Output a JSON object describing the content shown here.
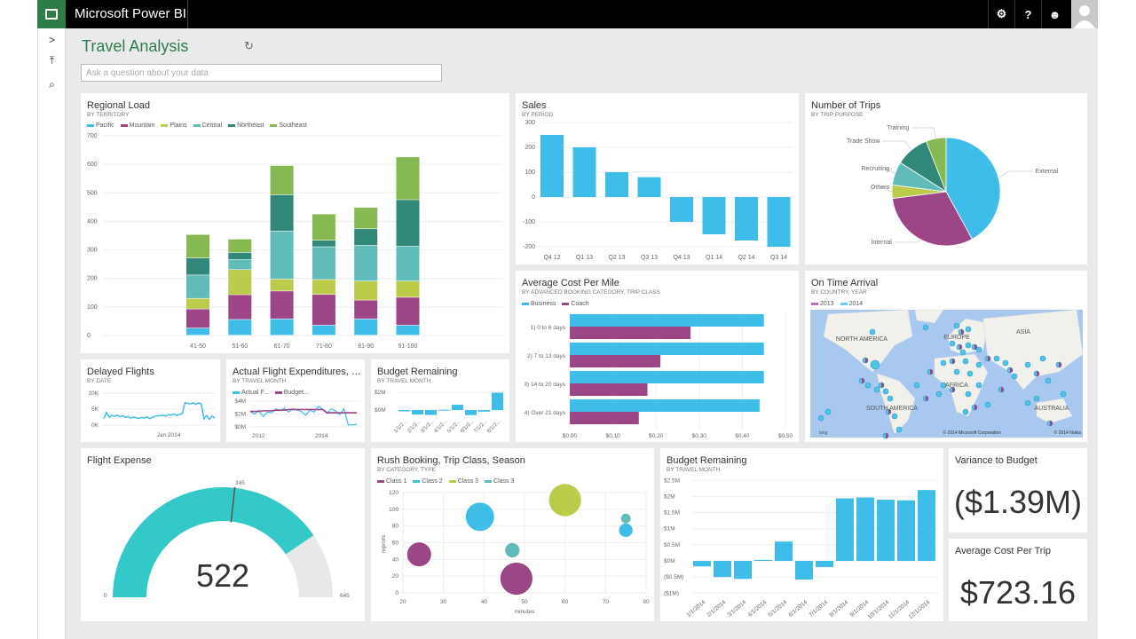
{
  "app": {
    "title": "Microsoft Power BI",
    "icons": [
      "gear-icon",
      "help-icon",
      "feedback-smiley-icon",
      "user-avatar-icon"
    ],
    "help_glyph": "?"
  },
  "nav": {
    "expand": ">",
    "pin": "⤒",
    "search": "⌕"
  },
  "dashboard": {
    "title": "Travel Analysis",
    "qa_placeholder": "Ask a question about your data"
  },
  "colors": {
    "pacific": "#3fbde9",
    "mountain": "#9c4587",
    "plains": "#bccb4a",
    "central": "#5fbcb9",
    "northeast": "#318878",
    "southeast": "#86b952",
    "gauge": "#33c9c9",
    "map": "#a9c8ef"
  },
  "tiles": {
    "regional": {
      "title": "Regional Load",
      "subtitle": "BY TERRITORY"
    },
    "sales": {
      "title": "Sales",
      "subtitle": "BY PERIOD"
    },
    "trips": {
      "title": "Number of Trips",
      "subtitle": "BY TRIP PURPOSE"
    },
    "cost_mile": {
      "title": "Average Cost Per Mile",
      "subtitle": "BY ADVANCED BOOKING CATEGORY, TRIP CLASS"
    },
    "ontime": {
      "title": "On Time Arrival",
      "subtitle": "BY COUNTRY, YEAR",
      "legend": [
        "2013",
        "2014"
      ],
      "labels": [
        "NORTH AMERICA",
        "EUROPE",
        "ASIA",
        "AFRICA",
        "SOUTH AMERICA",
        "AUSTRALIA"
      ],
      "credits": [
        "© 2014 Microsoft Corporation",
        "© 2014 Nokia"
      ],
      "brand": "bing"
    },
    "delayed": {
      "title": "Delayed Flights",
      "subtitle": "BY DATE"
    },
    "actual": {
      "title": "Actual Flight Expenditures, Bu...",
      "subtitle": "BY TRAVEL MONTH"
    },
    "budget_small": {
      "title": "Budget Remaining",
      "subtitle": "BY TRAVEL MONTH"
    },
    "flight_expense": {
      "title": "Flight Expense"
    },
    "rush": {
      "title": "Rush Booking, Trip Class, Season",
      "subtitle": "BY CATEGORY, TYPE"
    },
    "budget_large": {
      "title": "Budget Remaining",
      "subtitle": "BY TRAVEL MONTH"
    },
    "variance": {
      "title": "Variance to Budget",
      "value": "($1.39M)"
    },
    "cost_trip": {
      "title": "Average Cost Per Trip",
      "value": "$723.16"
    }
  },
  "chart_data": [
    {
      "id": "regional",
      "type": "bar",
      "stacked": true,
      "categories": [
        "41-50",
        "51-60",
        "61-70",
        "71-80",
        "81-90",
        "91-100"
      ],
      "ylim": [
        0,
        700
      ],
      "yticks": [
        0,
        100,
        200,
        300,
        400,
        500,
        600,
        700
      ],
      "legend": "top-left",
      "grid": true,
      "series": [
        {
          "name": "Pacific",
          "values": [
            25,
            55,
            57,
            35,
            57,
            35
          ]
        },
        {
          "name": "Mountain",
          "values": [
            67,
            87,
            98,
            108,
            66,
            98
          ]
        },
        {
          "name": "Plains",
          "values": [
            37,
            88,
            42,
            52,
            67,
            57
          ]
        },
        {
          "name": "Central",
          "values": [
            82,
            35,
            168,
            115,
            125,
            122
          ]
        },
        {
          "name": "Northeast",
          "values": [
            60,
            25,
            127,
            23,
            58,
            163
          ]
        },
        {
          "name": "Southeast",
          "values": [
            82,
            47,
            103,
            92,
            75,
            150
          ]
        }
      ]
    },
    {
      "id": "sales",
      "type": "bar",
      "categories": [
        "Q4 12",
        "Q1 13",
        "Q2 13",
        "Q3 13",
        "Q4 13",
        "Q1 14",
        "Q2 14",
        "Q3 14"
      ],
      "values": [
        250,
        200,
        100,
        80,
        -100,
        -150,
        -175,
        -200
      ],
      "ylim": [
        -200,
        300
      ],
      "yticks": [
        -200,
        -100,
        0,
        100,
        200,
        300
      ],
      "grid": true
    },
    {
      "id": "trips",
      "type": "pie",
      "labels": [
        "External",
        "Internal",
        "Others",
        "Recruiting",
        "Trade Show",
        "Training"
      ],
      "values": [
        42,
        31,
        4,
        7,
        10,
        6
      ]
    },
    {
      "id": "cost_mile",
      "type": "bar",
      "orientation": "horizontal",
      "categories": [
        "1) 0 to 6 days",
        "2) 7 to 13 days",
        "3) 14 to 20 days",
        "4) Over 21 days"
      ],
      "xlim": [
        0,
        0.5
      ],
      "xticks": [
        "$0.00",
        "$0.10",
        "$0.20",
        "$0.30",
        "$0.40",
        "$0.50"
      ],
      "legend": "top-left",
      "series": [
        {
          "name": "Business",
          "values": [
            0.45,
            0.45,
            0.45,
            0.44
          ]
        },
        {
          "name": "Coach",
          "values": [
            0.28,
            0.21,
            0.18,
            0.16
          ]
        }
      ]
    },
    {
      "id": "delayed",
      "type": "line",
      "yticks": [
        "0K",
        "5K",
        "10K"
      ],
      "ylim": [
        0,
        10
      ],
      "xlabel_ticks": [
        "Jan 2014"
      ],
      "values": [
        2,
        4,
        2.5,
        3,
        2.8,
        3.2,
        2.6,
        3,
        2.4,
        2.7,
        2.2,
        2.5,
        2.3,
        2.1,
        2.4,
        2.2,
        2.6,
        2,
        2.4,
        2.8,
        2.9,
        3,
        3.1,
        2.8,
        3.3,
        3.2,
        3.5,
        3,
        3.4,
        3.6,
        7,
        6.8,
        6.6,
        7,
        6.5,
        6.9,
        6.6,
        2,
        3,
        1.8,
        2.8,
        2.2
      ]
    },
    {
      "id": "actual",
      "type": "line",
      "yticks": [
        "$0M",
        "$2M",
        "$4M"
      ],
      "ylim": [
        0,
        4
      ],
      "xlabel_ticks": [
        "2012",
        "2014"
      ],
      "legend": "top-left",
      "series": [
        {
          "name": "Actual F...",
          "values": [
            2.4,
            2,
            2.6,
            1.6,
            2.3,
            2.2,
            2.8,
            2.5,
            2.9,
            2.3,
            2.8,
            2.6,
            2.4,
            1.8,
            2.6,
            2.3,
            3.2,
            2.7,
            2.1,
            2.8,
            2.5,
            1.9,
            2.8,
            0.3,
            0.3,
            0.4
          ]
        },
        {
          "name": "Budget...",
          "values": [
            2.4,
            2.4,
            2.4,
            2.5,
            2.5,
            2.5,
            2.6,
            2.6,
            2.6,
            2.7,
            2.7,
            2.7,
            2.7,
            2.7,
            2.7,
            2.7,
            2.7,
            2.7,
            2.2,
            2.2,
            2.2,
            2.2,
            2.2,
            2.2,
            2.2,
            2.2
          ]
        }
      ]
    },
    {
      "id": "budget_small",
      "type": "bar",
      "categories": [
        "1/1/2...",
        "2/1/2...",
        "3/1/2...",
        "4/1/2...",
        "5/1/2...",
        "6/1/2...",
        "7/1/2...",
        "8/1/2..."
      ],
      "values": [
        -0.15,
        -0.5,
        -0.55,
        0.03,
        0.6,
        -0.57,
        -0.18,
        1.95
      ],
      "yticks": [
        "$0M",
        "$2M"
      ],
      "ylim": [
        -1,
        2
      ]
    },
    {
      "id": "flight_expense",
      "type": "gauge",
      "value": 522,
      "min": 0,
      "max": 645,
      "target": 345,
      "labels": [
        "0",
        "345",
        "645"
      ]
    },
    {
      "id": "rush",
      "type": "scatter",
      "bubble": true,
      "xlabel": "minutes",
      "ylabel": "reprots",
      "xlim": [
        20,
        80
      ],
      "ylim": [
        0,
        120
      ],
      "xticks": [
        20,
        30,
        40,
        50,
        60,
        70,
        80
      ],
      "yticks": [
        0,
        20,
        40,
        60,
        80,
        100,
        120
      ],
      "legend": "top-left",
      "series": [
        {
          "name": "Class 1",
          "points": [
            {
              "x": 24,
              "y": 46,
              "size": 25
            },
            {
              "x": 48,
              "y": 17,
              "size": 45
            }
          ]
        },
        {
          "name": "Class 2",
          "points": [
            {
              "x": 39,
              "y": 91,
              "size": 35
            },
            {
              "x": 75,
              "y": 75,
              "size": 8
            }
          ]
        },
        {
          "name": "Class 3",
          "points": [
            {
              "x": 60,
              "y": 111,
              "size": 45
            }
          ]
        },
        {
          "name": "Class 3",
          "points": [
            {
              "x": 47,
              "y": 51,
              "size": 9
            },
            {
              "x": 75,
              "y": 89,
              "size": 4
            }
          ]
        }
      ]
    },
    {
      "id": "budget_large",
      "type": "bar",
      "categories": [
        "1/1/2014",
        "2/1/2014",
        "3/1/2014",
        "4/1/2014",
        "5/1/2014",
        "6/1/2014",
        "7/1/2014",
        "8/1/2014",
        "9/1/2014",
        "10/1/2014",
        "11/1/2014",
        "12/1/2014"
      ],
      "values": [
        -0.17,
        -0.5,
        -0.56,
        0.03,
        0.6,
        -0.58,
        -0.19,
        1.94,
        1.97,
        1.9,
        1.88,
        2.2
      ],
      "ylim": [
        -1,
        2.5
      ],
      "yticks": [
        "($1M)",
        "($0.5M)",
        "$0M",
        "$0.5M",
        "$1M",
        "$1.5M",
        "$2M",
        "$2.5M"
      ]
    }
  ]
}
